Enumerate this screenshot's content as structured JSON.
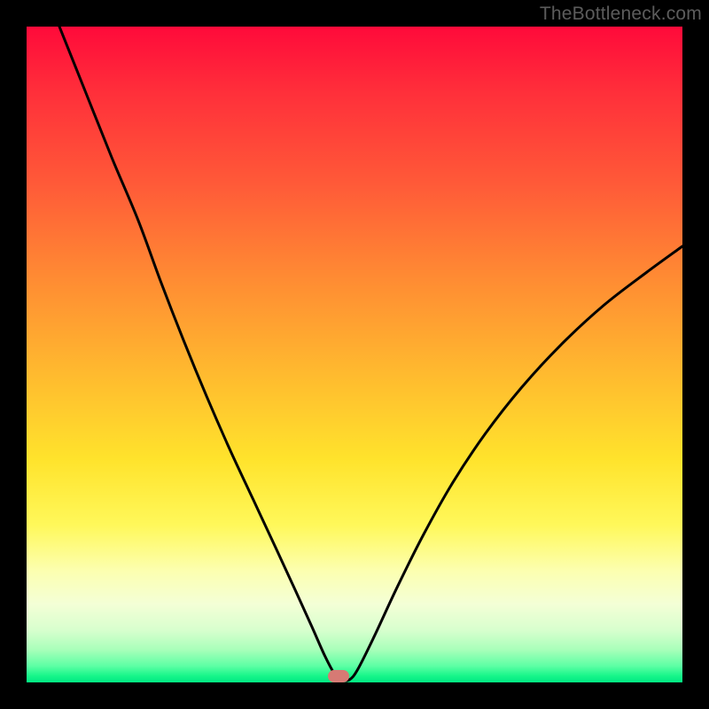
{
  "watermark": {
    "text": "TheBottleneck.com"
  },
  "marker": {
    "x_frac": 0.475,
    "y_frac": 0.991,
    "color": "#d67a74"
  },
  "chart_data": {
    "type": "line",
    "title": "",
    "xlabel": "",
    "ylabel": "",
    "xlim": [
      0,
      1
    ],
    "ylim": [
      0,
      1
    ],
    "gradient_stops": [
      {
        "pos": 0.0,
        "color": "#ff0a3a"
      },
      {
        "pos": 0.1,
        "color": "#ff2f3a"
      },
      {
        "pos": 0.24,
        "color": "#ff5a38"
      },
      {
        "pos": 0.38,
        "color": "#ff8a33"
      },
      {
        "pos": 0.52,
        "color": "#ffb72f"
      },
      {
        "pos": 0.66,
        "color": "#ffe32c"
      },
      {
        "pos": 0.76,
        "color": "#fff85a"
      },
      {
        "pos": 0.83,
        "color": "#fcffb0"
      },
      {
        "pos": 0.88,
        "color": "#f4ffd6"
      },
      {
        "pos": 0.92,
        "color": "#d8ffce"
      },
      {
        "pos": 0.95,
        "color": "#a9ffba"
      },
      {
        "pos": 0.975,
        "color": "#5dffa4"
      },
      {
        "pos": 0.99,
        "color": "#17f68a"
      },
      {
        "pos": 1.0,
        "color": "#00e882"
      }
    ],
    "series": [
      {
        "name": "bottleneck-curve",
        "points": [
          {
            "x": 0.05,
            "y": 1.0
          },
          {
            "x": 0.09,
            "y": 0.9
          },
          {
            "x": 0.13,
            "y": 0.8
          },
          {
            "x": 0.17,
            "y": 0.705
          },
          {
            "x": 0.205,
            "y": 0.61
          },
          {
            "x": 0.24,
            "y": 0.52
          },
          {
            "x": 0.275,
            "y": 0.435
          },
          {
            "x": 0.31,
            "y": 0.355
          },
          {
            "x": 0.345,
            "y": 0.28
          },
          {
            "x": 0.38,
            "y": 0.205
          },
          {
            "x": 0.41,
            "y": 0.14
          },
          {
            "x": 0.435,
            "y": 0.085
          },
          {
            "x": 0.455,
            "y": 0.04
          },
          {
            "x": 0.47,
            "y": 0.012
          },
          {
            "x": 0.478,
            "y": 0.004
          },
          {
            "x": 0.492,
            "y": 0.004
          },
          {
            "x": 0.505,
            "y": 0.02
          },
          {
            "x": 0.53,
            "y": 0.07
          },
          {
            "x": 0.565,
            "y": 0.145
          },
          {
            "x": 0.605,
            "y": 0.225
          },
          {
            "x": 0.65,
            "y": 0.305
          },
          {
            "x": 0.7,
            "y": 0.38
          },
          {
            "x": 0.755,
            "y": 0.45
          },
          {
            "x": 0.815,
            "y": 0.515
          },
          {
            "x": 0.88,
            "y": 0.575
          },
          {
            "x": 0.945,
            "y": 0.625
          },
          {
            "x": 1.0,
            "y": 0.665
          }
        ]
      }
    ],
    "marker": {
      "x": 0.475,
      "y": 0.009
    }
  }
}
